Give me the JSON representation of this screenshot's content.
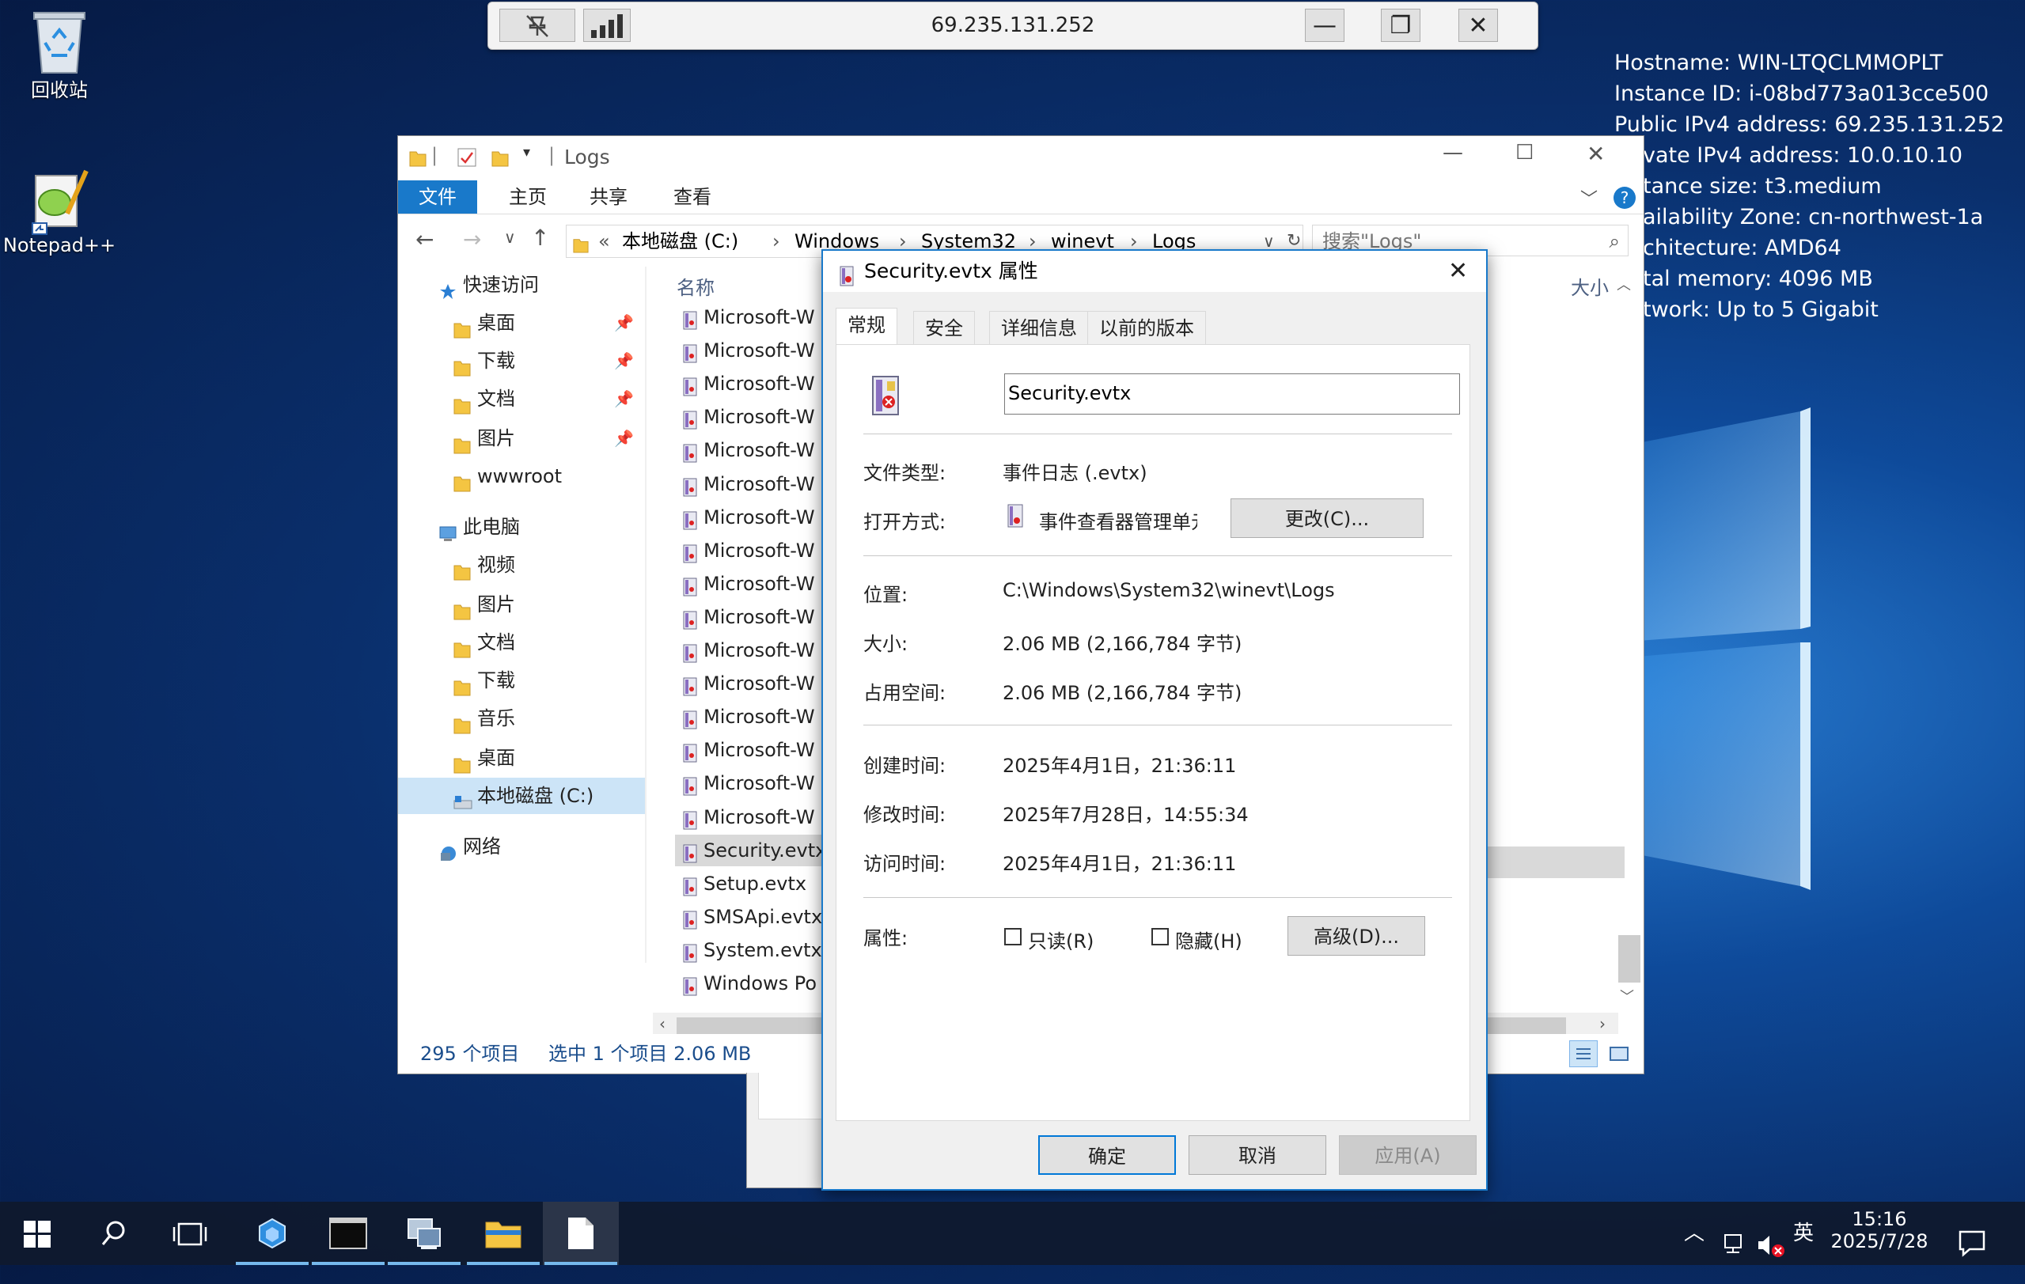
{
  "desktop": {
    "icons": [
      {
        "label": "回收站",
        "icon": "recycle-bin-icon"
      },
      {
        "label": "Notepad++",
        "icon": "notepad-plus-plus-icon"
      }
    ],
    "info_lines": [
      "Hostname: WIN-LTQCLMMOPLT",
      "Instance ID: i-08bd773a013cce500",
      "Public IPv4 address: 69.235.131.252",
      "vate IPv4 address: 10.0.10.10",
      "tance size: t3.medium",
      "ailability Zone: cn-northwest-1a",
      "chitecture: AMD64",
      "tal memory: 4096 MB",
      "twork: Up to 5 Gigabit"
    ]
  },
  "rdp_bar": {
    "ip": "69.235.131.252",
    "minimize": "—",
    "restore": "❐",
    "close": "✕"
  },
  "explorer": {
    "title": "Logs",
    "ribbon_tabs": [
      "文件",
      "主页",
      "共享",
      "查看"
    ],
    "address": {
      "overflow": "«",
      "crumbs": [
        "本地磁盘 (C:)",
        "Windows",
        "System32",
        "winevt",
        "Logs"
      ]
    },
    "search_placeholder": "搜索\"Logs\"",
    "column_name": "名称",
    "column_size": "大小",
    "nav": [
      {
        "label": "快速访问",
        "level": 0,
        "icon": "star-icon",
        "pinned": false
      },
      {
        "label": "桌面",
        "level": 1,
        "icon": "folder-icon",
        "pinned": true
      },
      {
        "label": "下载",
        "level": 1,
        "icon": "download-folder-icon",
        "pinned": true
      },
      {
        "label": "文档",
        "level": 1,
        "icon": "documents-folder-icon",
        "pinned": true
      },
      {
        "label": "图片",
        "level": 1,
        "icon": "pictures-folder-icon",
        "pinned": true
      },
      {
        "label": "wwwroot",
        "level": 1,
        "icon": "folder-icon",
        "pinned": false
      },
      {
        "label": "此电脑",
        "level": 0,
        "icon": "computer-icon",
        "pinned": false
      },
      {
        "label": "视频",
        "level": 1,
        "icon": "videos-folder-icon",
        "pinned": false
      },
      {
        "label": "图片",
        "level": 1,
        "icon": "pictures-folder-icon",
        "pinned": false
      },
      {
        "label": "文档",
        "level": 1,
        "icon": "documents-folder-icon",
        "pinned": false
      },
      {
        "label": "下载",
        "level": 1,
        "icon": "download-folder-icon",
        "pinned": false
      },
      {
        "label": "音乐",
        "level": 1,
        "icon": "music-folder-icon",
        "pinned": false
      },
      {
        "label": "桌面",
        "level": 1,
        "icon": "folder-icon",
        "pinned": false
      },
      {
        "label": "本地磁盘 (C:)",
        "level": 1,
        "icon": "drive-icon",
        "pinned": false,
        "selected": true
      },
      {
        "label": "网络",
        "level": 0,
        "icon": "network-icon",
        "pinned": false
      }
    ],
    "files": [
      "Microsoft-W",
      "Microsoft-W",
      "Microsoft-W",
      "Microsoft-W",
      "Microsoft-W",
      "Microsoft-W",
      "Microsoft-W",
      "Microsoft-W",
      "Microsoft-W",
      "Microsoft-W",
      "Microsoft-W",
      "Microsoft-W",
      "Microsoft-W",
      "Microsoft-W",
      "Microsoft-W",
      "Microsoft-W",
      "Security.evtx",
      "Setup.evtx",
      "SMSApi.evtx",
      "System.evtx",
      "Windows Po"
    ],
    "selected_file": "Security.evtx",
    "status": {
      "count": "295 个项目",
      "selection": "选中 1 个项目  2.06 MB"
    }
  },
  "dialog": {
    "title": "Security.evtx 属性",
    "tabs": [
      "常规",
      "安全",
      "详细信息",
      "以前的版本"
    ],
    "active_tab": "常规",
    "filename": "Security.evtx",
    "rows": {
      "type_label": "文件类型:",
      "type_value": "事件日志 (.evtx)",
      "open_label": "打开方式:",
      "open_value": "事件查看器管理单元启动",
      "change_button": "更改(C)...",
      "location_label": "位置:",
      "location_value": "C:\\Windows\\System32\\winevt\\Logs",
      "size_label": "大小:",
      "size_value": "2.06 MB (2,166,784 字节)",
      "disk_label": "占用空间:",
      "disk_value": "2.06 MB (2,166,784 字节)",
      "created_label": "创建时间:",
      "created_value": "2025年4月1日，21:36:11",
      "modified_label": "修改时间:",
      "modified_value": "2025年7月28日，14:55:34",
      "accessed_label": "访问时间:",
      "accessed_value": "2025年4月1日，21:36:11",
      "attr_label": "属性:",
      "readonly_label": "只读(R)",
      "hidden_label": "隐藏(H)",
      "advanced_button": "高级(D)..."
    },
    "buttons": {
      "ok": "确定",
      "cancel": "取消",
      "apply": "应用(A)"
    }
  },
  "taskbar": {
    "items": [
      "start",
      "search",
      "task-view",
      "server-manager",
      "cmd",
      "network-tool",
      "file-explorer",
      "notepad"
    ],
    "tray": {
      "ime": "英"
    },
    "clock": {
      "time": "15:16",
      "date": "2025/7/28"
    }
  },
  "colors": {
    "accent": "#1979ca",
    "selection": "#cce4f7",
    "taskbar_underline": "#76b9ed"
  }
}
